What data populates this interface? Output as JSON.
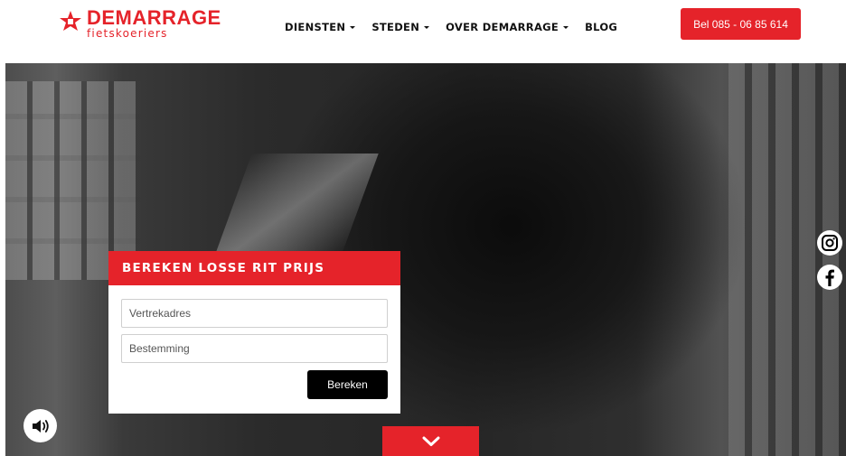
{
  "brand": {
    "name": "DEMARRAGE",
    "tagline": "fietskoeriers",
    "accent_color": "#e5232a"
  },
  "nav": {
    "items": [
      {
        "label": "DIENSTEN",
        "has_dropdown": true
      },
      {
        "label": "STEDEN",
        "has_dropdown": true
      },
      {
        "label": "OVER DEMARRAGE",
        "has_dropdown": true
      },
      {
        "label": "BLOG",
        "has_dropdown": false
      }
    ]
  },
  "header": {
    "call_label": "Bel 085 - 06 85 614"
  },
  "calculator": {
    "title": "BEREKEN LOSSE RIT PRIJS",
    "from_placeholder": "Vertrekadres",
    "to_placeholder": "Bestemming",
    "submit_label": "Bereken"
  },
  "social": {
    "icons": [
      "instagram-icon",
      "facebook-icon"
    ]
  },
  "controls": {
    "sound_icon": "speaker-icon",
    "scroll_icon": "chevron-down-icon"
  }
}
